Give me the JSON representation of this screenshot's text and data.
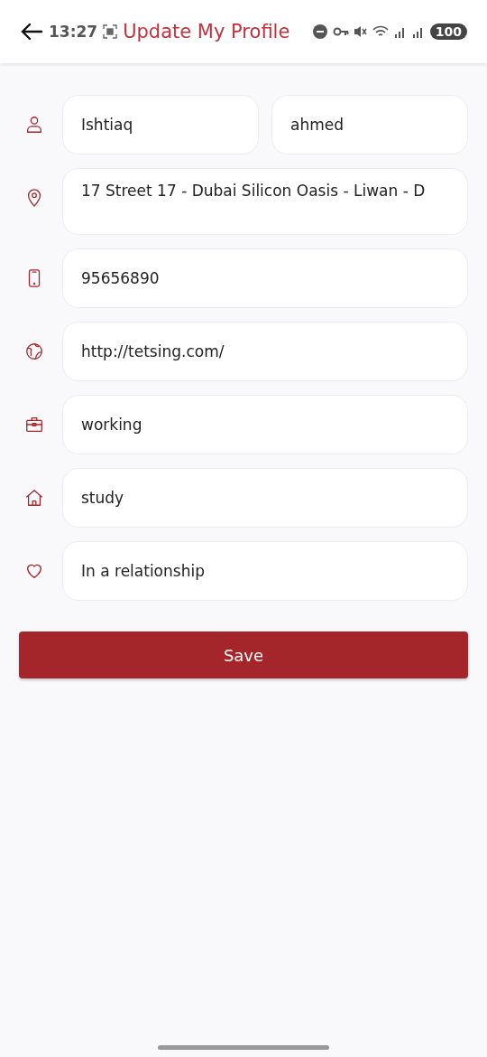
{
  "header": {
    "time": "13:27",
    "title": "Update My Profile",
    "battery": "100"
  },
  "rows": [
    {
      "kind": "person",
      "fields": [
        {
          "value": "Ishtiaq",
          "kind": "single"
        },
        {
          "value": "ahmed",
          "kind": "single"
        }
      ]
    },
    {
      "kind": "location",
      "fields": [
        {
          "value": "17 Street 17 - Dubai Silicon Oasis - Liwan - D",
          "kind": "multiline"
        }
      ]
    },
    {
      "kind": "phone",
      "fields": [
        {
          "value": "95656890",
          "kind": "single"
        }
      ]
    },
    {
      "kind": "globe",
      "fields": [
        {
          "value": "http://tetsing.com/",
          "kind": "single"
        }
      ]
    },
    {
      "kind": "briefcase",
      "fields": [
        {
          "value": "working",
          "kind": "single"
        }
      ]
    },
    {
      "kind": "home",
      "fields": [
        {
          "value": "study",
          "kind": "single"
        }
      ]
    },
    {
      "kind": "heart",
      "fields": [
        {
          "value": "In a relationship",
          "kind": "single"
        }
      ]
    }
  ],
  "save_button": "Save"
}
